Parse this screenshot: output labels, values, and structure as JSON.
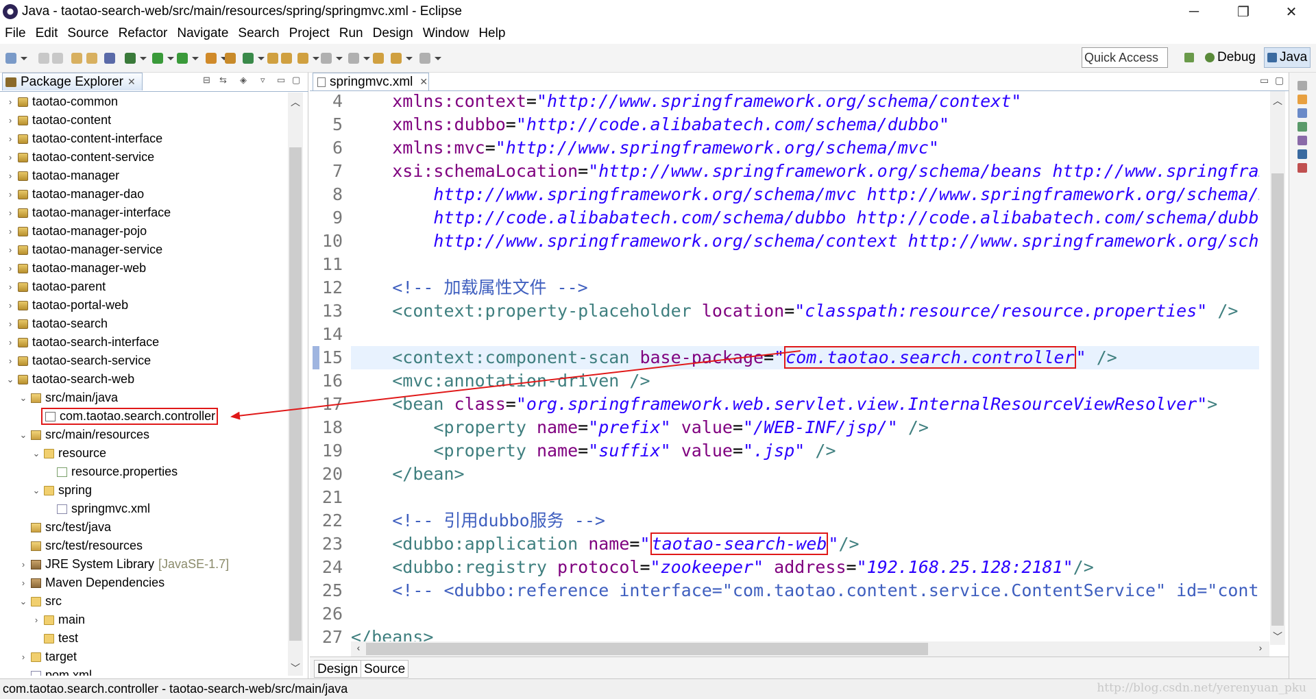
{
  "window": {
    "title": "Java - taotao-search-web/src/main/resources/spring/springmvc.xml - Eclipse",
    "minimize": "─",
    "maximize": "❐",
    "close": "✕"
  },
  "menu": [
    "File",
    "Edit",
    "Source",
    "Refactor",
    "Navigate",
    "Search",
    "Project",
    "Run",
    "Design",
    "Window",
    "Help"
  ],
  "toolbar": {
    "quick_access": "Quick Access",
    "perspectives": [
      "Debug",
      "Java"
    ]
  },
  "package_explorer": {
    "title": "Package Explorer",
    "items": [
      {
        "label": "taotao-common",
        "depth": 0,
        "arrow": "›",
        "icon": "proj"
      },
      {
        "label": "taotao-content",
        "depth": 0,
        "arrow": "›",
        "icon": "proj"
      },
      {
        "label": "taotao-content-interface",
        "depth": 0,
        "arrow": "›",
        "icon": "proj"
      },
      {
        "label": "taotao-content-service",
        "depth": 0,
        "arrow": "›",
        "icon": "proj"
      },
      {
        "label": "taotao-manager",
        "depth": 0,
        "arrow": "›",
        "icon": "proj"
      },
      {
        "label": "taotao-manager-dao",
        "depth": 0,
        "arrow": "›",
        "icon": "proj"
      },
      {
        "label": "taotao-manager-interface",
        "depth": 0,
        "arrow": "›",
        "icon": "proj"
      },
      {
        "label": "taotao-manager-pojo",
        "depth": 0,
        "arrow": "›",
        "icon": "proj"
      },
      {
        "label": "taotao-manager-service",
        "depth": 0,
        "arrow": "›",
        "icon": "proj"
      },
      {
        "label": "taotao-manager-web",
        "depth": 0,
        "arrow": "›",
        "icon": "proj"
      },
      {
        "label": "taotao-parent",
        "depth": 0,
        "arrow": "›",
        "icon": "proj"
      },
      {
        "label": "taotao-portal-web",
        "depth": 0,
        "arrow": "›",
        "icon": "proj"
      },
      {
        "label": "taotao-search",
        "depth": 0,
        "arrow": "›",
        "icon": "proj"
      },
      {
        "label": "taotao-search-interface",
        "depth": 0,
        "arrow": "›",
        "icon": "proj"
      },
      {
        "label": "taotao-search-service",
        "depth": 0,
        "arrow": "›",
        "icon": "proj"
      },
      {
        "label": "taotao-search-web",
        "depth": 0,
        "arrow": "⌄",
        "icon": "proj"
      },
      {
        "label": "src/main/java",
        "depth": 1,
        "arrow": "⌄",
        "icon": "srcf"
      },
      {
        "label": "com.taotao.search.controller",
        "depth": 2,
        "arrow": "",
        "icon": "pkg",
        "highlight": true
      },
      {
        "label": "src/main/resources",
        "depth": 1,
        "arrow": "⌄",
        "icon": "srcf"
      },
      {
        "label": "resource",
        "depth": 2,
        "arrow": "⌄",
        "icon": "fold"
      },
      {
        "label": "resource.properties",
        "depth": 3,
        "arrow": "",
        "icon": "file"
      },
      {
        "label": "spring",
        "depth": 2,
        "arrow": "⌄",
        "icon": "fold"
      },
      {
        "label": "springmvc.xml",
        "depth": 3,
        "arrow": "",
        "icon": "xml"
      },
      {
        "label": "src/test/java",
        "depth": 1,
        "arrow": "",
        "icon": "srcf"
      },
      {
        "label": "src/test/resources",
        "depth": 1,
        "arrow": "",
        "icon": "srcf"
      },
      {
        "label": "JRE System Library",
        "depth": 1,
        "arrow": "›",
        "icon": "lib",
        "suffix": "[JavaSE-1.7]"
      },
      {
        "label": "Maven Dependencies",
        "depth": 1,
        "arrow": "›",
        "icon": "lib"
      },
      {
        "label": "src",
        "depth": 1,
        "arrow": "⌄",
        "icon": "fold"
      },
      {
        "label": "main",
        "depth": 2,
        "arrow": "›",
        "icon": "fold"
      },
      {
        "label": "test",
        "depth": 2,
        "arrow": "",
        "icon": "fold"
      },
      {
        "label": "target",
        "depth": 1,
        "arrow": "›",
        "icon": "fold"
      },
      {
        "label": "pom.xml",
        "depth": 1,
        "arrow": "",
        "icon": "xml"
      }
    ]
  },
  "editor": {
    "tab": "springmvc.xml",
    "current_line": 15,
    "lines": [
      {
        "n": "4",
        "t": [
          [
            "    ",
            ""
          ],
          [
            "xmlns:context",
            "attr"
          ],
          [
            "=",
            "eq"
          ],
          [
            "\"http://www.springframework.org/schema/context\"",
            "str"
          ]
        ]
      },
      {
        "n": "5",
        "t": [
          [
            "    ",
            ""
          ],
          [
            "xmlns:dubbo",
            "attr"
          ],
          [
            "=",
            "eq"
          ],
          [
            "\"http://code.alibabatech.com/schema/dubbo\"",
            "str"
          ]
        ]
      },
      {
        "n": "6",
        "t": [
          [
            "    ",
            ""
          ],
          [
            "xmlns:mvc",
            "attr"
          ],
          [
            "=",
            "eq"
          ],
          [
            "\"http://www.springframework.org/schema/mvc\"",
            "str"
          ]
        ]
      },
      {
        "n": "7",
        "t": [
          [
            "    ",
            ""
          ],
          [
            "xsi:schemaLocation",
            "attr"
          ],
          [
            "=",
            "eq"
          ],
          [
            "\"http://www.springframework.org/schema/beans http://www.springframework.org/schema/beans/spring-beans.xsd",
            "str"
          ]
        ]
      },
      {
        "n": "8",
        "t": [
          [
            "        ",
            ""
          ],
          [
            "http://www.springframework.org/schema/mvc http://www.springframework.org/schema/mvc/spring-mvc.xsd",
            "str"
          ]
        ]
      },
      {
        "n": "9",
        "t": [
          [
            "        ",
            ""
          ],
          [
            "http://code.alibabatech.com/schema/dubbo http://code.alibabatech.com/schema/dubbo/dubbo.xsd",
            "str"
          ]
        ]
      },
      {
        "n": "10",
        "t": [
          [
            "        ",
            ""
          ],
          [
            "http://www.springframework.org/schema/context http://www.springframework.org/schema/context/spring-context.xsd\">",
            "str"
          ]
        ]
      },
      {
        "n": "11",
        "t": []
      },
      {
        "n": "12",
        "t": [
          [
            "    ",
            ""
          ],
          [
            "<!-- 加载属性文件 -->",
            "cmt"
          ]
        ]
      },
      {
        "n": "13",
        "t": [
          [
            "    ",
            ""
          ],
          [
            "<context:property-placeholder ",
            "tag"
          ],
          [
            "location",
            "attr"
          ],
          [
            "=",
            "eq"
          ],
          [
            "\"classpath:resource/resource.properties\"",
            "str"
          ],
          [
            " />",
            "tag"
          ]
        ]
      },
      {
        "n": "14",
        "t": []
      },
      {
        "n": "15",
        "t": [
          [
            "    ",
            ""
          ],
          [
            "<context:component-scan ",
            "tag"
          ],
          [
            "base-package",
            "attr"
          ],
          [
            "=",
            "eq"
          ],
          [
            "\"",
            "str"
          ],
          [
            "com.taotao.search.controller",
            "str",
            "box1"
          ],
          [
            "\"",
            "str"
          ],
          [
            " />",
            "tag"
          ]
        ]
      },
      {
        "n": "16",
        "t": [
          [
            "    ",
            ""
          ],
          [
            "<mvc:annotation-driven />",
            "tag"
          ]
        ]
      },
      {
        "n": "17",
        "t": [
          [
            "    ",
            ""
          ],
          [
            "<bean ",
            "tag"
          ],
          [
            "class",
            "attr"
          ],
          [
            "=",
            "eq"
          ],
          [
            "\"org.springframework.web.servlet.view.InternalResourceViewResolver\"",
            "str"
          ],
          [
            ">",
            "tag"
          ]
        ]
      },
      {
        "n": "18",
        "t": [
          [
            "        ",
            ""
          ],
          [
            "<property ",
            "tag"
          ],
          [
            "name",
            "attr"
          ],
          [
            "=",
            "eq"
          ],
          [
            "\"prefix\"",
            "str"
          ],
          [
            " ",
            ""
          ],
          [
            "value",
            "attr"
          ],
          [
            "=",
            "eq"
          ],
          [
            "\"/WEB-INF/jsp/\"",
            "str"
          ],
          [
            " />",
            "tag"
          ]
        ]
      },
      {
        "n": "19",
        "t": [
          [
            "        ",
            ""
          ],
          [
            "<property ",
            "tag"
          ],
          [
            "name",
            "attr"
          ],
          [
            "=",
            "eq"
          ],
          [
            "\"suffix\"",
            "str"
          ],
          [
            " ",
            ""
          ],
          [
            "value",
            "attr"
          ],
          [
            "=",
            "eq"
          ],
          [
            "\".jsp\"",
            "str"
          ],
          [
            " />",
            "tag"
          ]
        ]
      },
      {
        "n": "20",
        "t": [
          [
            "    ",
            ""
          ],
          [
            "</bean>",
            "tag"
          ]
        ]
      },
      {
        "n": "21",
        "t": []
      },
      {
        "n": "22",
        "t": [
          [
            "    ",
            ""
          ],
          [
            "<!-- 引用dubbo服务 -->",
            "cmt"
          ]
        ]
      },
      {
        "n": "23",
        "t": [
          [
            "    ",
            ""
          ],
          [
            "<dubbo:application ",
            "tag"
          ],
          [
            "name",
            "attr"
          ],
          [
            "=",
            "eq"
          ],
          [
            "\"",
            "str"
          ],
          [
            "taotao-search-web",
            "str",
            "box2"
          ],
          [
            "\"",
            "str"
          ],
          [
            "/>",
            "tag"
          ]
        ]
      },
      {
        "n": "24",
        "t": [
          [
            "    ",
            ""
          ],
          [
            "<dubbo:registry ",
            "tag"
          ],
          [
            "protocol",
            "attr"
          ],
          [
            "=",
            "eq"
          ],
          [
            "\"zookeeper\"",
            "str"
          ],
          [
            " ",
            ""
          ],
          [
            "address",
            "attr"
          ],
          [
            "=",
            "eq"
          ],
          [
            "\"192.168.25.128:2181\"",
            "str"
          ],
          [
            "/>",
            "tag"
          ]
        ]
      },
      {
        "n": "25",
        "t": [
          [
            "    ",
            ""
          ],
          [
            "<!-- <dubbo:reference interface=\"com.taotao.content.service.ContentService\" id=\"contentService\" /> -->",
            "cmt"
          ]
        ]
      },
      {
        "n": "26",
        "t": []
      },
      {
        "n": "27",
        "t": [
          [
            "",
            ""
          ],
          [
            "</beans>",
            "tag"
          ]
        ]
      }
    ],
    "bottom_tabs": [
      "Design",
      "Source"
    ],
    "active_bottom_tab": "Source"
  },
  "statusbar": {
    "text": "com.taotao.search.controller - taotao-search-web/src/main/java"
  },
  "watermark": "http://blog.csdn.net/yerenyuan_pku",
  "colors": {
    "annotation": "#e01818",
    "tag": "#3f7f7f",
    "attr": "#7f007f",
    "string": "#2a00ff",
    "comment": "#3f5fbf"
  }
}
